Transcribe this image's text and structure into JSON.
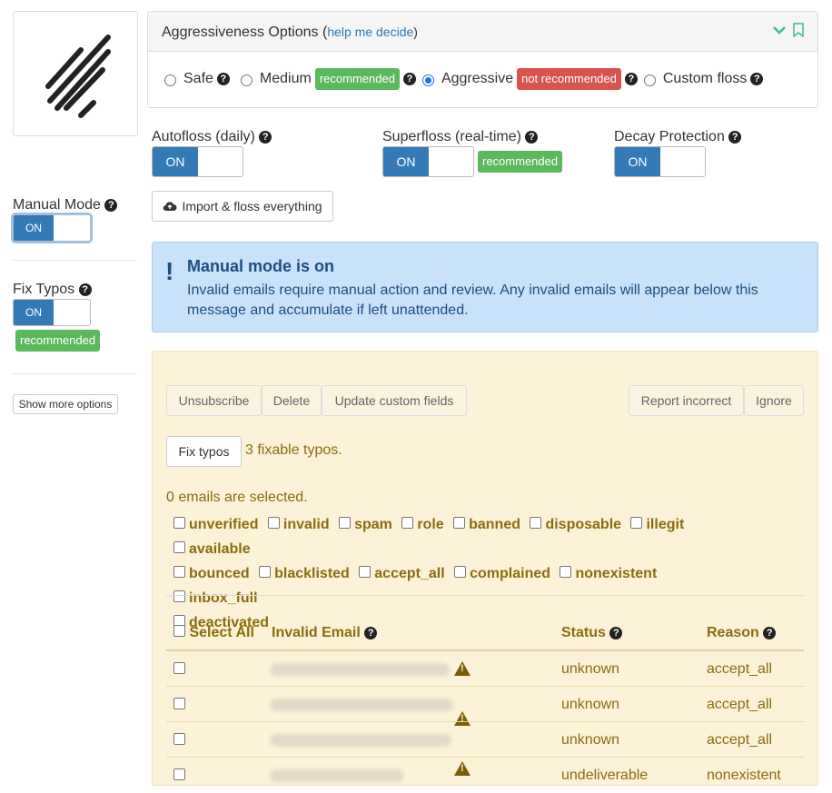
{
  "aggr": {
    "title": "Aggressiveness Options",
    "help_open": "(",
    "help_link": "help me decide",
    "help_close": ")",
    "options": [
      {
        "label": "Safe",
        "checked": false
      },
      {
        "label": "Medium",
        "checked": false,
        "badge": "recommended"
      },
      {
        "label": "Aggressive",
        "checked": true,
        "badge": "not recommended"
      },
      {
        "label": "Custom floss",
        "checked": false
      }
    ]
  },
  "toggles": {
    "autofloss": {
      "label": "Autofloss (daily)",
      "state": "ON"
    },
    "superfloss": {
      "label": "Superfloss (real-time)",
      "state": "ON",
      "badge": "recommended"
    },
    "decay": {
      "label": "Decay Protection",
      "state": "ON"
    }
  },
  "import_button": "Import & floss everything",
  "sidebar": {
    "manual_mode": {
      "label": "Manual Mode",
      "state": "ON"
    },
    "fix_typos": {
      "label": "Fix Typos",
      "state": "ON",
      "badge": "recommended"
    },
    "more_options": "Show more options"
  },
  "alert": {
    "title": "Manual mode is on",
    "message": "Invalid emails require manual action and review. Any invalid emails will appear below this message and accumulate if left unattended."
  },
  "actions": {
    "unsubscribe": "Unsubscribe",
    "delete": "Delete",
    "update": "Update custom fields",
    "report": "Report incorrect",
    "ignore": "Ignore",
    "fix_typos": "Fix typos",
    "fixable": "3 fixable typos."
  },
  "selected_text": "0 emails are selected.",
  "filters": [
    "unverified",
    "invalid",
    "spam",
    "role",
    "banned",
    "disposable",
    "illegit",
    "available",
    "bounced",
    "blacklisted",
    "accept_all",
    "complained",
    "nonexistent",
    "inbox_full",
    "deactivated"
  ],
  "table": {
    "headers": {
      "select": "Select All",
      "email": "Invalid Email",
      "status": "Status",
      "reason": "Reason"
    },
    "rows": [
      {
        "status": "unknown",
        "reason": "accept_all",
        "warn": true
      },
      {
        "status": "unknown",
        "reason": "accept_all",
        "warn": true
      },
      {
        "status": "unknown",
        "reason": "accept_all",
        "warn": true
      },
      {
        "status": "undeliverable",
        "reason": "nonexistent",
        "warn": false
      }
    ]
  },
  "colors": {
    "primary": "#337ab7",
    "success": "#5cb85c",
    "danger": "#d9534f",
    "warning_text": "#8a6d0f"
  }
}
